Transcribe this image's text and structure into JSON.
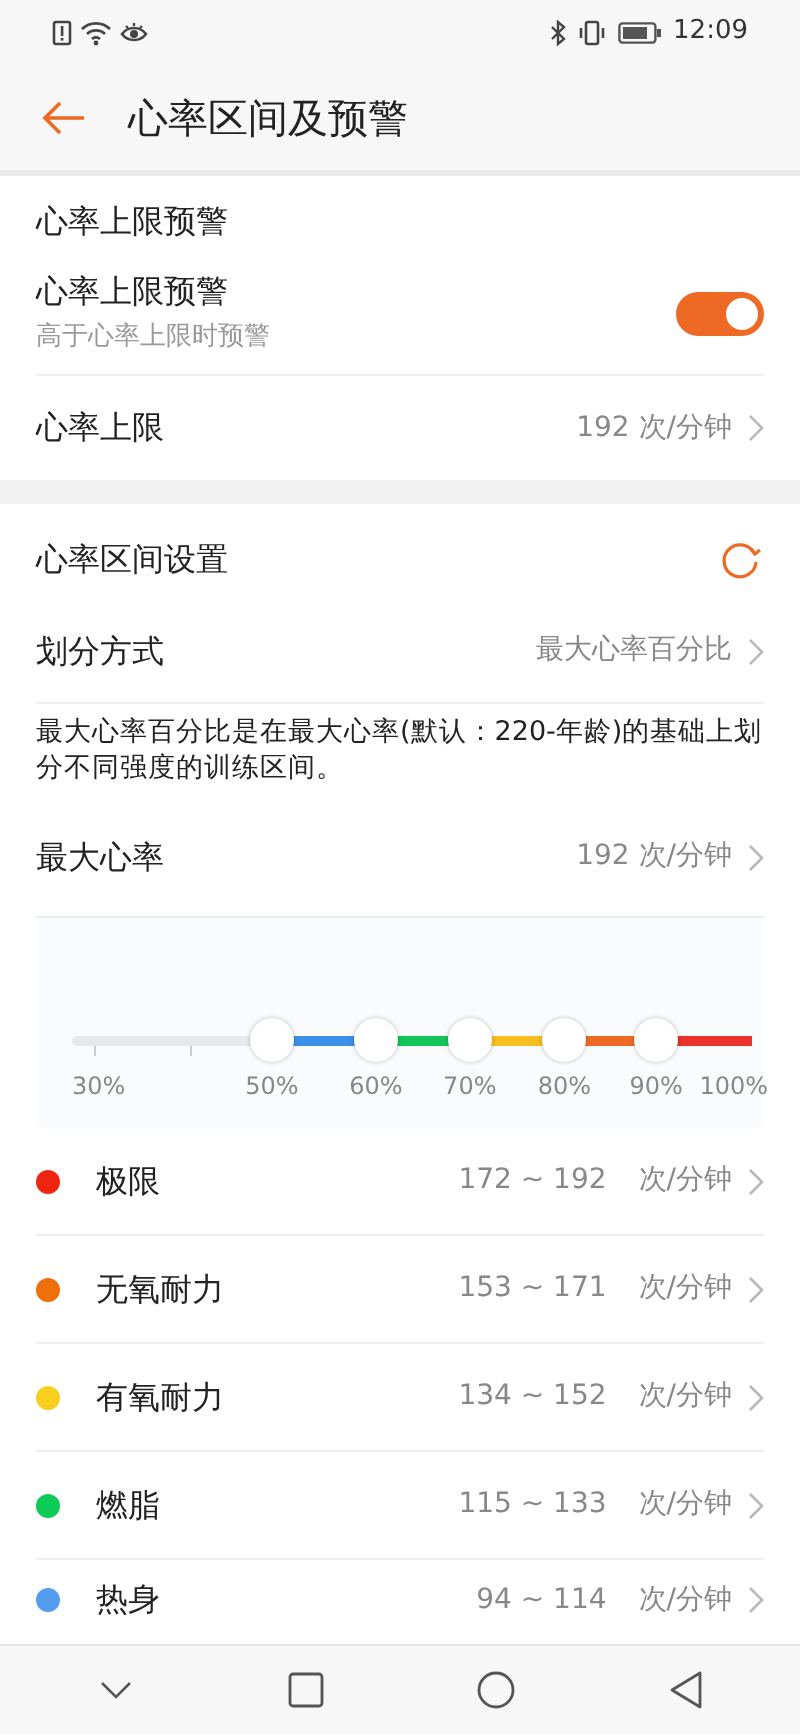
{
  "status_bar": {
    "time": "12:09"
  },
  "header": {
    "title": "心率区间及预警"
  },
  "alert_section": {
    "title": "心率上限预警",
    "toggle": {
      "label": "心率上限预警",
      "hint": "高于心率上限时预警",
      "on": true
    },
    "limit": {
      "label": "心率上限",
      "value": "192 次/分钟"
    }
  },
  "zone_section": {
    "title": "心率区间设置",
    "method": {
      "label": "划分方式",
      "value": "最大心率百分比"
    },
    "description": "最大心率百分比是在最大心率(默认：220-年龄)的基础上划分不同强度的训练区间。",
    "max_rate": {
      "label": "最大心率",
      "value": "192 次/分钟"
    },
    "slider": {
      "start_label": "30%",
      "end_label": "100%",
      "handles": [
        {
          "label": "50%",
          "level": 0.294,
          "color": "#3b8fe8"
        },
        {
          "label": "60%",
          "level": 0.447,
          "color": "#12c55a"
        },
        {
          "label": "70%",
          "level": 0.585,
          "color": "#f7bd1e"
        },
        {
          "label": "80%",
          "level": 0.724,
          "color": "#ee6a24"
        },
        {
          "label": "90%",
          "level": 0.859,
          "color": "#e8322a"
        }
      ]
    },
    "zones": [
      {
        "name": "极限",
        "range": "172 ~ 192",
        "unit": "次/分钟",
        "color": "#f02510"
      },
      {
        "name": "无氧耐力",
        "range": "153 ~ 171",
        "unit": "次/分钟",
        "color": "#ee700c"
      },
      {
        "name": "有氧耐力",
        "range": "134 ~ 152",
        "unit": "次/分钟",
        "color": "#f8cf1c"
      },
      {
        "name": "燃脂",
        "range": "115 ~ 133",
        "unit": "次/分钟",
        "color": "#0ecb58"
      },
      {
        "name": "热身",
        "range": "94 ~ 114",
        "unit": "次/分钟",
        "color": "#539df0"
      }
    ]
  }
}
